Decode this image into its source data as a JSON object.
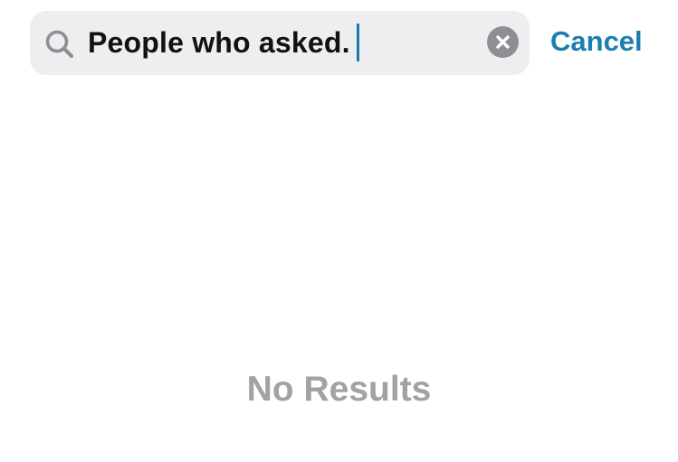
{
  "search": {
    "query": "People who asked.",
    "icon": "search-icon",
    "clear_icon": "clear-icon"
  },
  "cancel_label": "Cancel",
  "results": {
    "empty_message": "No Results"
  },
  "colors": {
    "accent": "#1a7fb0",
    "caret": "#1c7aa8",
    "search_bg": "#eeeef0",
    "muted_text": "#a2a2a6",
    "icon_gray": "#8e8e93"
  }
}
